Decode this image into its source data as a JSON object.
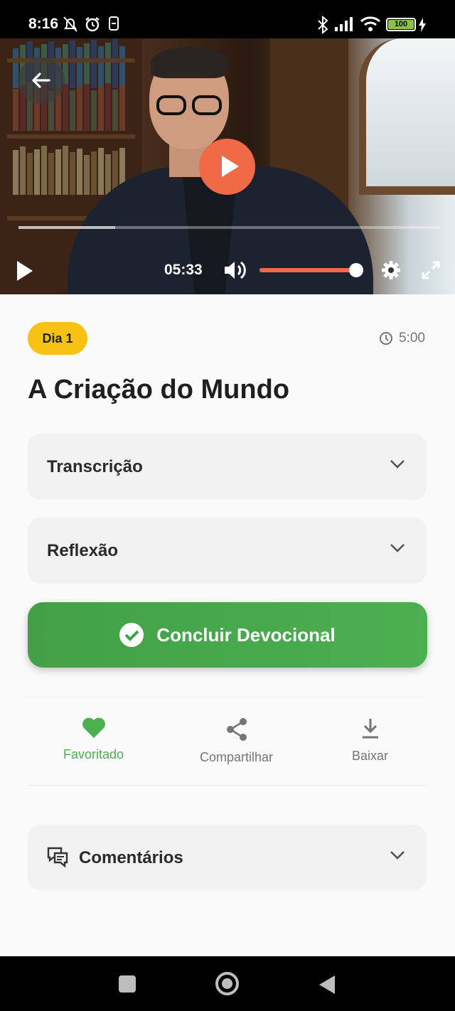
{
  "status_bar": {
    "time": "8:16",
    "battery": "100",
    "icons": [
      "bell-off-icon",
      "alarm-icon",
      "sim-icon",
      "bluetooth-icon",
      "signal-icon",
      "wifi-icon",
      "battery-icon",
      "charging-icon"
    ]
  },
  "video": {
    "time": "05:33",
    "progress_fraction": 0.23,
    "volume_fraction": 1.0,
    "accent_color": "#f06a48"
  },
  "devotional": {
    "day_badge": "Dia 1",
    "duration": "5:00",
    "title": "A Criação do Mundo"
  },
  "sections": {
    "transcription": "Transcrição",
    "reflection": "Reflexão",
    "comments": "Comentários"
  },
  "complete_button": {
    "label": "Concluir Devocional",
    "color": "#4caf50"
  },
  "actions": {
    "favorite": "Favoritado",
    "share": "Compartilhar",
    "download": "Baixar"
  },
  "colors": {
    "badge": "#f8c215",
    "favorite_active": "#4caf50"
  }
}
